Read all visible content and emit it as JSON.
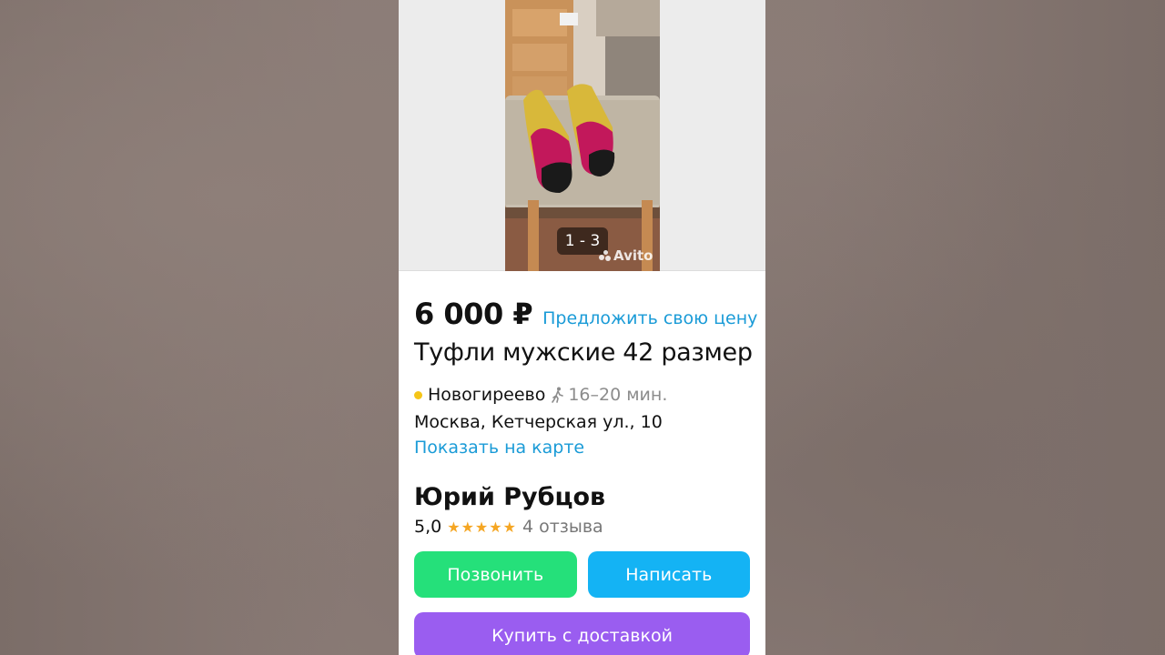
{
  "gallery": {
    "counter": "1 - 3",
    "watermark": "Avito",
    "photo_icon": "shoe-photo"
  },
  "listing": {
    "price": "6 000 ₽",
    "offer_link": "Предложить свою цену",
    "title": "Туфли мужские 42 размер",
    "metro": {
      "station": "Новогиреево",
      "line_color": "#f5c518",
      "walk_icon": "walking-person-icon",
      "walk_time": "16–20 мин."
    },
    "address": "Москва, Кетчерская ул., 10",
    "map_link": "Показать на карте"
  },
  "seller": {
    "name": "Юрий Рубцов",
    "rating": "5,0",
    "stars": "★★★★★",
    "reviews": "4 отзыва"
  },
  "actions": {
    "call_label": "Позвонить",
    "write_label": "Написать",
    "buy_label": "Купить с доставкой"
  },
  "colors": {
    "link": "#1a9bd7",
    "call": "#25e07a",
    "write": "#14b3f4",
    "buy": "#9a5df0",
    "star": "#f5a623"
  }
}
